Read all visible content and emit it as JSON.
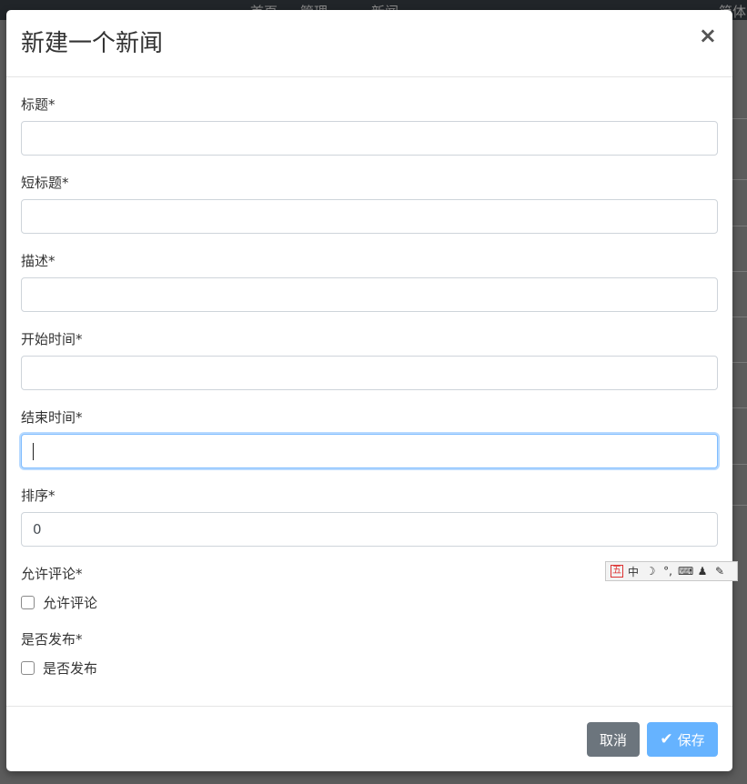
{
  "background": {
    "nav_items": [
      "首页",
      "管理",
      "新闻"
    ],
    "nav_right": "简体"
  },
  "modal": {
    "title": "新建一个新闻",
    "close_symbol": "×"
  },
  "form": {
    "title_label": "标题*",
    "title_value": "",
    "short_title_label": "短标题*",
    "short_title_value": "",
    "description_label": "描述*",
    "description_value": "",
    "start_time_label": "开始时间*",
    "start_time_value": "",
    "end_time_label": "结束时间*",
    "end_time_value": "",
    "order_label": "排序*",
    "order_value": "0",
    "allow_comment_label": "允许评论*",
    "allow_comment_checkbox": "允许评论",
    "allow_comment_checked": false,
    "publish_label": "是否发布*",
    "publish_checkbox": "是否发布",
    "publish_checked": false
  },
  "ime_toolbar": {
    "icons": [
      "wubi-icon",
      "chinese-mode-icon",
      "moon-icon",
      "punctuation-icon",
      "keyboard-icon",
      "user-icon",
      "wrench-icon"
    ],
    "wubi": "五",
    "mode": "中",
    "punct": "°,"
  },
  "footer": {
    "cancel_label": "取消",
    "save_label": "保存",
    "save_icon": "check-icon"
  },
  "colors": {
    "cancel_button": "#6c757d",
    "save_button": "#66b3ff",
    "focus_border": "#80bdff"
  }
}
